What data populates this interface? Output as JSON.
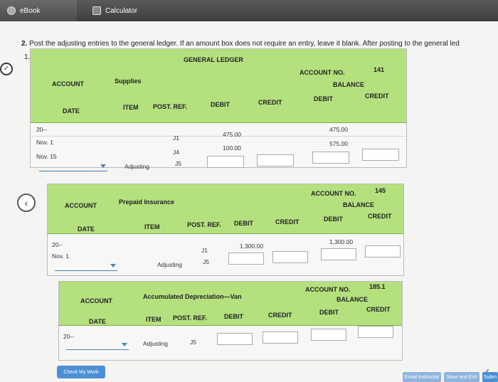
{
  "tabs": {
    "ebook": "eBook",
    "calculator": "Calculator"
  },
  "question": {
    "number": "2.",
    "text": "Post the adjusting entries to the general ledger. If an amount box does not require an entry, leave it blank. After posting to the general led",
    "sub": "1."
  },
  "ledger1": {
    "title": "GENERAL LEDGER",
    "account_label": "ACCOUNT",
    "account_name": "Supplies",
    "account_no_label": "ACCOUNT NO.",
    "account_no": "141",
    "balance_label": "BALANCE",
    "cols": {
      "date": "DATE",
      "item": "ITEM",
      "post_ref": "POST. REF.",
      "debit": "DEBIT",
      "credit": "CREDIT",
      "bal_debit": "DEBIT",
      "bal_credit": "CREDIT"
    },
    "rows": [
      {
        "date": "20--"
      },
      {
        "date": "Nov. 1",
        "post_ref": "J1",
        "debit": "475.00",
        "bal_debit": "475.00"
      },
      {
        "date": "Nov. 15",
        "post_ref": "J4",
        "debit": "100.00",
        "bal_debit": "575.00"
      },
      {
        "item": "Adjusting",
        "post_ref": "J5"
      }
    ]
  },
  "ledger2": {
    "account_label": "ACCOUNT",
    "account_name": "Prepaid Insurance",
    "account_no_label": "ACCOUNT NO.",
    "account_no": "145",
    "balance_label": "BALANCE",
    "cols": {
      "date": "DATE",
      "item": "ITEM",
      "post_ref": "POST. REF.",
      "debit": "DEBIT",
      "credit": "CREDIT",
      "bal_debit": "DEBIT",
      "bal_credit": "CREDIT"
    },
    "rows": [
      {
        "date": "20--"
      },
      {
        "date": "Nov. 1",
        "post_ref": "J1",
        "debit": "1,300.00",
        "bal_debit": "1,300.00"
      },
      {
        "item": "Adjusting",
        "post_ref": "J5"
      }
    ]
  },
  "ledger3": {
    "account_label": "ACCOUNT",
    "account_name": "Accumulated Depreciation—Van",
    "account_no_label": "ACCOUNT NO.",
    "account_no": "185.1",
    "balance_label": "BALANCE",
    "cols": {
      "date": "DATE",
      "item": "ITEM",
      "post_ref": "POST. REF.",
      "debit": "DEBIT",
      "credit": "CREDIT",
      "bal_debit": "DEBIT",
      "bal_credit": "CREDIT"
    },
    "rows": [
      {
        "date": "20--"
      },
      {
        "item": "Adjusting",
        "post_ref": "J5"
      }
    ]
  },
  "footer": {
    "check_work": "Check My Work",
    "email_instructor": "Email Instructor",
    "save_exit": "Save and Exit",
    "submit": "Subm"
  },
  "colors": {
    "header_green": "#b4e07e",
    "accent_blue": "#4b8fd4"
  }
}
